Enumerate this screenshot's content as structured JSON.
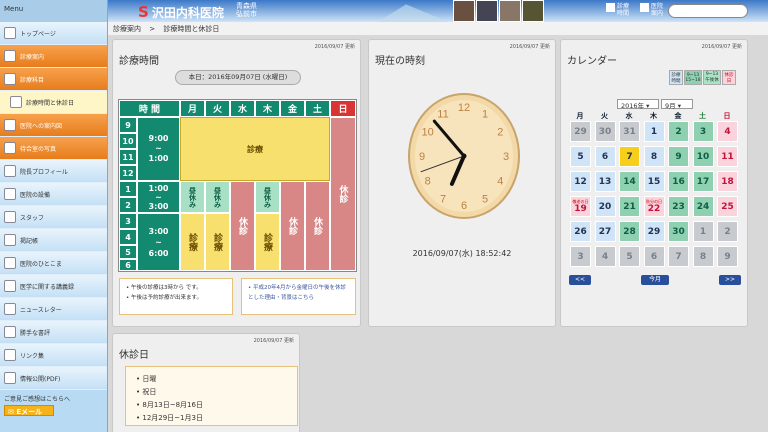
{
  "menu": {
    "title": "Menu",
    "items": [
      "トップページ",
      "診療案内",
      "診療科目",
      "診療時間と休診日",
      "医院への案内図",
      "待合室の写真",
      "院長プロフィール",
      "医院の設備",
      "スタッフ",
      "掲記帳",
      "医院のひとこま",
      "医学に関する講義録",
      "ニュースレター",
      "勝手な書評",
      "リンク集",
      "情報公開(PDF)"
    ],
    "footer": "ご意見ご感想はこちらへ",
    "mail_label": "Eメール"
  },
  "header": {
    "logo": "沢田内科医院",
    "pref1": "青森県",
    "pref2": "弘前市",
    "link1a": "診療",
    "link1b": "時間",
    "link2a": "医院",
    "link2b": "案内",
    "search_placeholder": ""
  },
  "breadcrumb": {
    "item1": "診療案内",
    "sep": ">",
    "item2": "診療時間と休診日"
  },
  "hours": {
    "updated": "2016/09/07 更新",
    "title": "診療時間",
    "today": "本日：2016年09月07日 (水曜日)",
    "header_time": "時 間",
    "days": [
      "月",
      "火",
      "水",
      "木",
      "金",
      "土",
      "日"
    ],
    "hours_col": [
      "9",
      "10",
      "11",
      "12",
      "1",
      "2",
      "3",
      "4",
      "5",
      "6"
    ],
    "am_time1": "9:00",
    "am_tilde": "~",
    "am_time2": "1:00",
    "pm_time1a": "1:00",
    "pm_time1b": "~",
    "pm_time1c": "3:00",
    "pm_time2a": "3:00",
    "pm_time2b": "~",
    "pm_time2c": "6:00",
    "shinryo": "診療",
    "kyushin": "休診",
    "hiruyasumi": "昼休み",
    "note1": "午後の診療は3時から です。",
    "note2": "午後は予約診療が出来ます。",
    "note3": "平成20年4月から金曜日の午後を休診とした理由・背景はこちら"
  },
  "clock": {
    "updated": "2016/09/07 更新",
    "title": "現在の時刻",
    "datetime": "2016/09/07(水) 18:52:42",
    "hour": 18,
    "minute": 52,
    "second": 42,
    "numbers": [
      "12",
      "1",
      "2",
      "3",
      "4",
      "5",
      "6",
      "7",
      "8",
      "9",
      "10",
      "11"
    ]
  },
  "calendar": {
    "updated": "2016/09/07 更新",
    "title": "カレンダー",
    "legend": [
      "診療時間",
      "9~13 15~18",
      "9~13 午後休",
      "休診日"
    ],
    "year": "2016年",
    "month": "9月",
    "dows": [
      "月",
      "火",
      "水",
      "木",
      "金",
      "土",
      "日"
    ],
    "weeks": [
      [
        "29",
        "30",
        "31",
        "1",
        "2",
        "3",
        "4"
      ],
      [
        "5",
        "6",
        "7",
        "8",
        "9",
        "10",
        "11"
      ],
      [
        "12",
        "13",
        "14",
        "15",
        "16",
        "17",
        "18"
      ],
      [
        "19",
        "20",
        "21",
        "22",
        "23",
        "24",
        "25"
      ],
      [
        "26",
        "27",
        "28",
        "29",
        "30",
        "1",
        "2"
      ],
      [
        "3",
        "4",
        "5",
        "6",
        "7",
        "8",
        "9"
      ]
    ],
    "note_19": "敬老の日",
    "note_22": "秋分の日",
    "prev": "<<",
    "today": "今月",
    "next": ">>",
    "colors": {
      "full": "#cfe4f7",
      "half": "#8fd0b0",
      "closed": "#fbd3dc",
      "out": "#c7cbd0",
      "today": "#f7cf1a"
    }
  },
  "holidays": {
    "updated": "2016/09/07 更新",
    "title": "休診日",
    "items": [
      "日曜",
      "祝日",
      "8月13日~8月16日",
      "12月29日~1月3日"
    ]
  }
}
